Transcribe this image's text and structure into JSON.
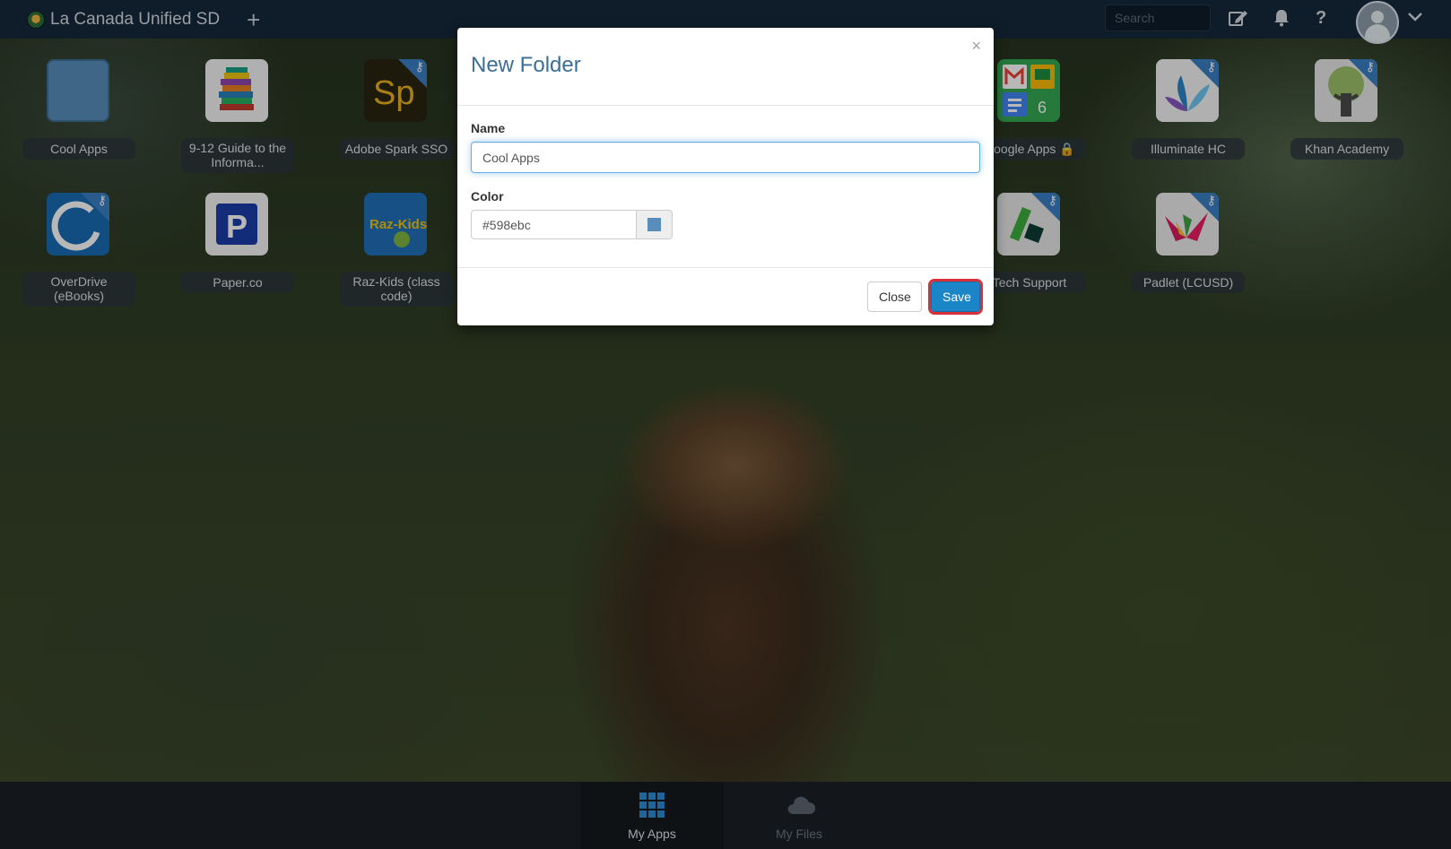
{
  "app": {
    "title": "La Canada Unified SD"
  },
  "topbar": {
    "search_placeholder": "Search",
    "icons": [
      "plus-icon",
      "edit-icon",
      "bell-icon",
      "help-icon",
      "avatar",
      "chevron-down-icon"
    ]
  },
  "tiles": [
    {
      "label": "Cool Apps",
      "icon": "folder-icon"
    },
    {
      "label": "9-12 Guide to the Informa...",
      "icon": "books-icon"
    },
    {
      "label": "Adobe Spark SSO",
      "icon": "adobe-spark-icon"
    },
    {
      "label": "Google Apps 🔒",
      "icon": "google-apps-icon",
      "badge": "6"
    },
    {
      "label": "Illuminate HC",
      "icon": "illuminate-icon"
    },
    {
      "label": "Khan Academy",
      "icon": "khan-academy-icon"
    },
    {
      "label": "OverDrive (eBooks)",
      "icon": "overdrive-icon"
    },
    {
      "label": "Paper.co",
      "icon": "paper-icon"
    },
    {
      "label": "Raz-Kids (class code)",
      "icon": "raz-kids-icon",
      "icon_text": "Raz-Kids"
    },
    {
      "label": "Tech Support",
      "icon": "tech-support-icon"
    },
    {
      "label": "Padlet (LCUSD)",
      "icon": "padlet-icon"
    }
  ],
  "modal": {
    "title": "New Folder",
    "close_x": "×",
    "name_label": "Name",
    "name_value": "Cool Apps",
    "color_label": "Color",
    "color_value": "#598ebc",
    "close_button": "Close",
    "save_button": "Save"
  },
  "bottom_nav": {
    "tabs": [
      {
        "label": "My Apps",
        "icon": "grid-icon",
        "active": true
      },
      {
        "label": "My Files",
        "icon": "cloud-icon",
        "active": false
      }
    ]
  },
  "colors": {
    "topbar": "#16273a",
    "accent": "#1a86c8",
    "folder": "#598ebc",
    "highlight": "#d8303a"
  }
}
